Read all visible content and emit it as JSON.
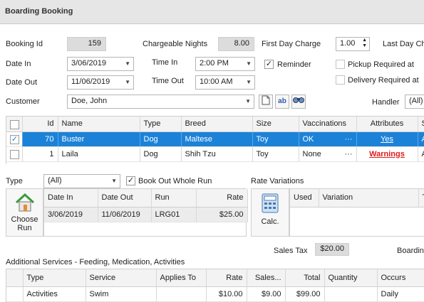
{
  "window": {
    "title": "Boarding Booking"
  },
  "form": {
    "booking_id_label": "Booking Id",
    "booking_id": "159",
    "nights_label": "Chargeable Nights",
    "nights": "8.00",
    "first_day_label": "First Day Charge",
    "first_day_value": "1.00",
    "last_day_label": "Last Day Ch",
    "date_in_label": "Date In",
    "date_in": "3/06/2019",
    "time_in_label": "Time In",
    "time_in": "2:00 PM",
    "reminder_label": "Reminder",
    "pickup_label": "Pickup Required at",
    "date_out_label": "Date Out",
    "date_out": "11/06/2019",
    "time_out_label": "Time Out",
    "time_out": "10:00 AM",
    "delivery_label": "Delivery Required at",
    "customer_label": "Customer",
    "customer": "Doe, John",
    "handler_label": "Handler",
    "handler": "(All)"
  },
  "pets": {
    "headers": [
      "Id",
      "Name",
      "Type",
      "Breed",
      "Size",
      "Vaccinations",
      "Attributes",
      "S"
    ],
    "rows": [
      {
        "checked": "✓",
        "id": "70",
        "name": "Buster",
        "type": "Dog",
        "breed": "Maltese",
        "size": "Toy",
        "vacc": "OK",
        "vacc_more": "···",
        "attr": "Yes",
        "s": "A"
      },
      {
        "checked": "",
        "id": "1",
        "name": "Laila",
        "type": "Dog",
        "breed": "Shih Tzu",
        "size": "Toy",
        "vacc": "None",
        "vacc_more": "···",
        "attr": "Warnings",
        "s": "A"
      }
    ]
  },
  "run": {
    "type_label": "Type",
    "type_value": "(All)",
    "bookout_label": "Book Out Whole Run",
    "choose_label": "Choose Run",
    "headers": [
      "Date In",
      "Date Out",
      "Run",
      "Rate"
    ],
    "rows": [
      {
        "date_in": "3/06/2019",
        "date_out": "11/06/2019",
        "run": "LRG01",
        "rate": "$25.00"
      }
    ]
  },
  "rates": {
    "title": "Rate Variations",
    "calc_label": "Calc.",
    "headers": [
      "Used",
      "Variation",
      "T"
    ]
  },
  "tax": {
    "label": "Sales Tax",
    "value": "$20.00",
    "boarding_label": "Boarding"
  },
  "services": {
    "title": "Additional Services - Feeding, Medication, Activities",
    "headers": [
      "Type",
      "Service",
      "Applies To",
      "Rate",
      "Sales...",
      "Total",
      "Quantity",
      "Occurs"
    ],
    "rows": [
      {
        "type": "Activities",
        "service": "Swim",
        "applies": "",
        "rate": "$10.00",
        "sales": "$9.00",
        "total": "$99.00",
        "qty": "",
        "occurs": "Daily"
      }
    ]
  },
  "colors": {
    "selection": "#1c82d8",
    "warning": "#e01b1b",
    "title_bar": "#e6e6e6"
  },
  "icons": [
    "new-document-icon",
    "spell-check-icon",
    "binoculars-icon",
    "house-icon",
    "calculator-icon",
    "checkmark-icon",
    "chevron-down-icon"
  ]
}
